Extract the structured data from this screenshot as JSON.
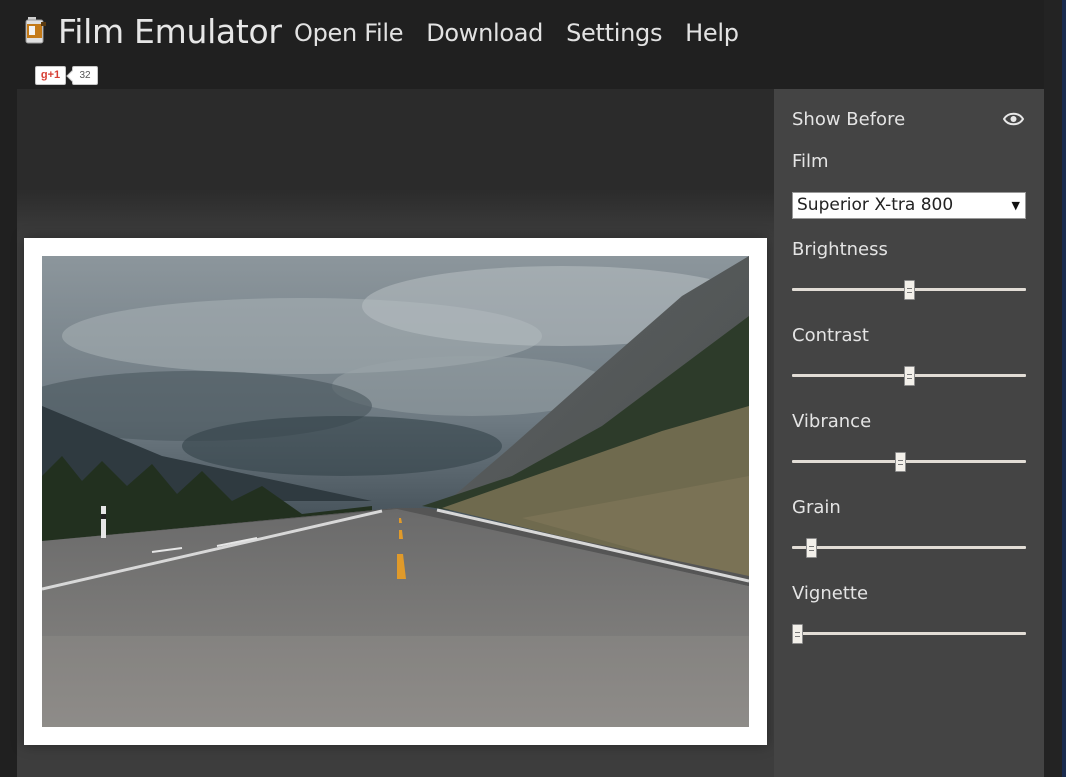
{
  "header": {
    "app_title": "Film Emulator",
    "logo_icon": "film-canister-icon",
    "nav": [
      {
        "label": "Open File"
      },
      {
        "label": "Download"
      },
      {
        "label": "Settings"
      },
      {
        "label": "Help"
      }
    ],
    "gplus": {
      "label": "g+1",
      "count": "32"
    }
  },
  "panel": {
    "show_before_label": "Show Before",
    "show_before_icon": "eye-icon",
    "film_label": "Film",
    "film_selected": "Superior X-tra 800",
    "sliders": [
      {
        "label": "Brightness",
        "value": 0.5
      },
      {
        "label": "Contrast",
        "value": 0.5
      },
      {
        "label": "Vibrance",
        "value": 0.46
      },
      {
        "label": "Grain",
        "value": 0.08
      },
      {
        "label": "Vignette",
        "value": 0.02
      }
    ]
  },
  "colors": {
    "background": "#202020",
    "panel": "#444444",
    "accent_road_line": "#e09a2a"
  }
}
